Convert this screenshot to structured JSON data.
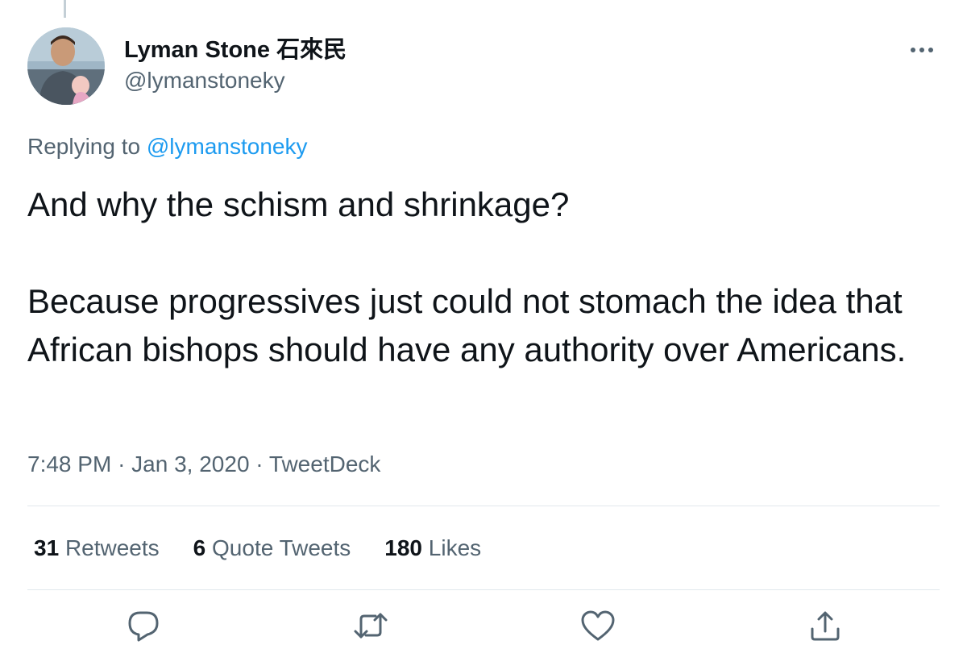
{
  "tweet": {
    "author": {
      "display_name": "Lyman Stone 石來民",
      "handle": "@lymanstoneky"
    },
    "replying_prefix": "Replying to",
    "replying_to": "@lymanstoneky",
    "paragraphs": [
      "And why the schism and shrinkage?",
      "Because progressives just could not stomach the idea that African bishops should have any authority over Americans."
    ],
    "time": "7:48 PM",
    "separator": "·",
    "date": "Jan 3, 2020",
    "source": "TweetDeck",
    "stats": {
      "retweets": {
        "count": "31",
        "label": "Retweets"
      },
      "quotes": {
        "count": "6",
        "label": "Quote Tweets"
      },
      "likes": {
        "count": "180",
        "label": "Likes"
      }
    }
  },
  "icons": {
    "more": "more-horizontal-icon",
    "reply": "reply-icon",
    "retweet": "retweet-icon",
    "like": "heart-icon",
    "share": "share-icon"
  },
  "colors": {
    "text": "#0f1419",
    "secondary": "#536471",
    "link": "#1d9bf0",
    "divider": "#e1e8ed"
  }
}
